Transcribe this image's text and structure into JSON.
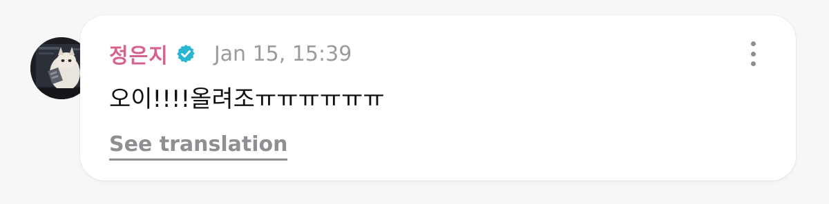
{
  "comment": {
    "author": "정은지",
    "verified_icon": "verified-badge-icon",
    "timestamp": "Jan 15, 15:39",
    "text": "오이!!!!올려조ㅠㅠㅠㅠㅠㅠ",
    "translation_link": "See translation",
    "more_icon": "more-vertical-icon"
  },
  "colors": {
    "author": "#d4638f",
    "verified": "#29b6d3",
    "muted": "#8e8e93"
  }
}
